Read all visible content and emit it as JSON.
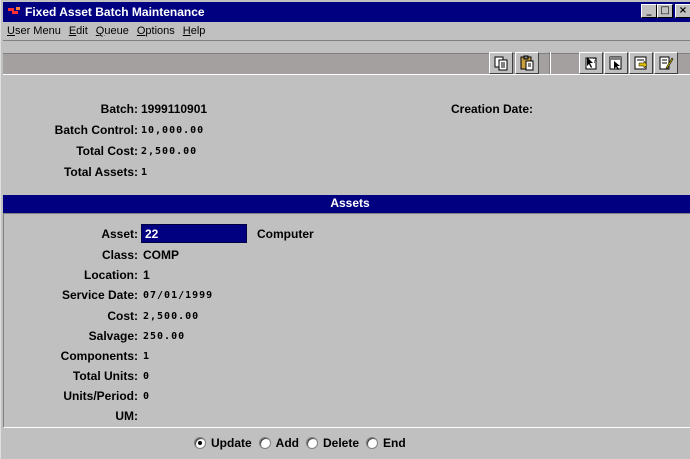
{
  "window": {
    "title": "Fixed Asset Batch Maintenance",
    "minimize_glyph": "_",
    "maximize_glyph": "□",
    "close_glyph": "×"
  },
  "menu": {
    "items": [
      {
        "label": "User Menu"
      },
      {
        "label": "Edit"
      },
      {
        "label": "Queue"
      },
      {
        "label": "Options"
      },
      {
        "label": "Help"
      }
    ]
  },
  "toolbar": {
    "icons": [
      "copy-icon",
      "paste-icon",
      "help-pointer-icon",
      "record-help-icon",
      "export-icon",
      "notes-icon"
    ]
  },
  "batch": {
    "batch_label": "Batch:",
    "batch_value": "1999110901",
    "creation_date_label": "Creation Date:",
    "creation_date_value": "",
    "batch_control_label": "Batch Control:",
    "batch_control_value": "10,000.00",
    "total_cost_label": "Total Cost:",
    "total_cost_value": "2,500.00",
    "total_assets_label": "Total Assets:",
    "total_assets_value": "1"
  },
  "assets": {
    "section_title": "Assets",
    "asset_label": "Asset:",
    "asset_value": "22",
    "asset_description": "Computer",
    "class_label": "Class:",
    "class_value": "COMP",
    "location_label": "Location:",
    "location_value": "1",
    "service_date_label": "Service Date:",
    "service_date_value": "07/01/1999",
    "cost_label": "Cost:",
    "cost_value": "2,500.00",
    "salvage_label": "Salvage:",
    "salvage_value": "250.00",
    "components_label": "Components:",
    "components_value": "1",
    "total_units_label": "Total Units:",
    "total_units_value": "0",
    "units_period_label": "Units/Period:",
    "units_period_value": "0",
    "um_label": "UM:",
    "um_value": ""
  },
  "mode": {
    "options": [
      {
        "label": "Update",
        "selected": true
      },
      {
        "label": "Add",
        "selected": false
      },
      {
        "label": "Delete",
        "selected": false
      },
      {
        "label": "End",
        "selected": false
      }
    ]
  },
  "colors": {
    "title_bar": "#000080",
    "face": "#c0c0c0",
    "selection": "#000080"
  }
}
